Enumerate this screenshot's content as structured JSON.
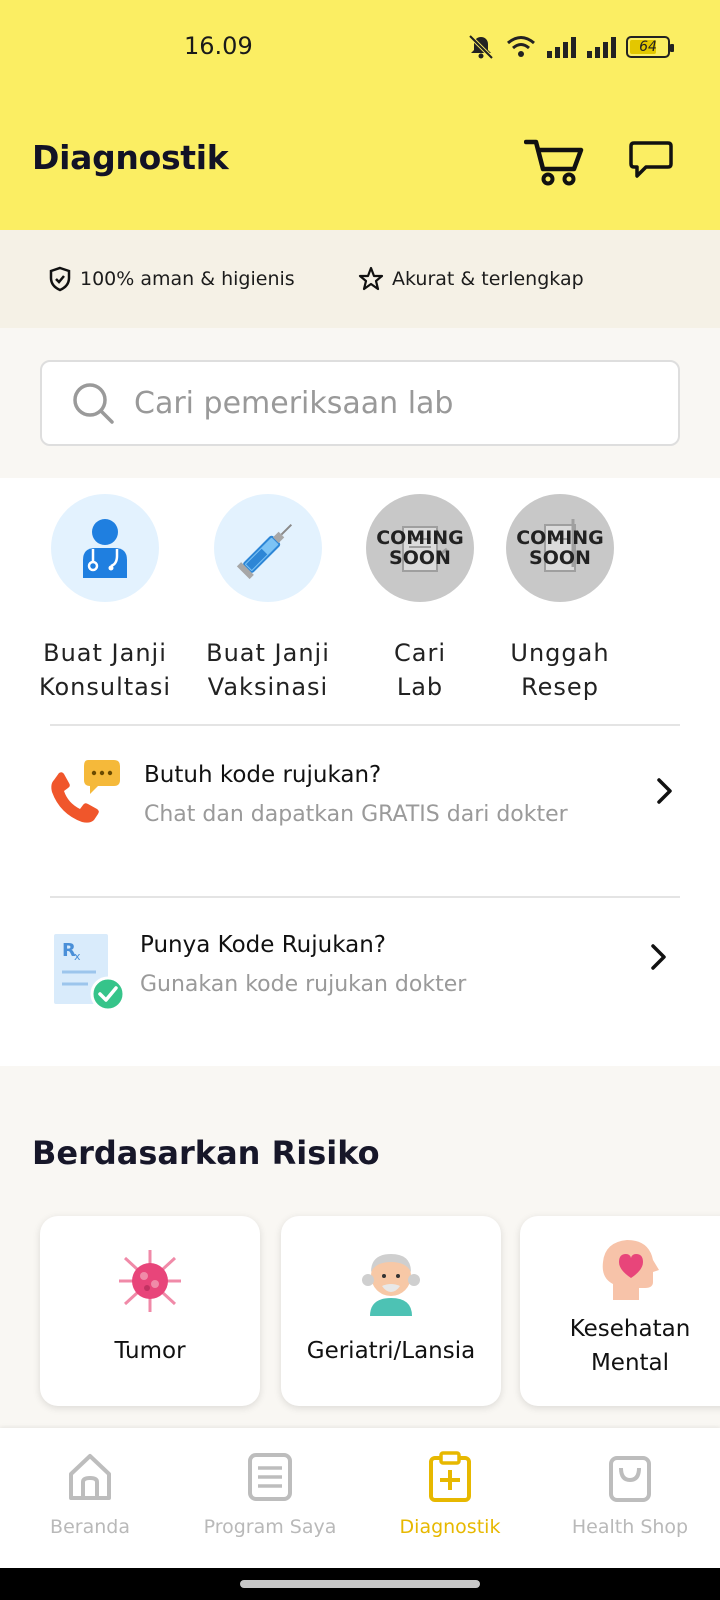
{
  "status_bar": {
    "time": "16.09",
    "battery": "64"
  },
  "header": {
    "title": "Diagnostik"
  },
  "assurances": [
    {
      "icon": "shield-icon",
      "label": "100% aman & higienis"
    },
    {
      "icon": "star-icon",
      "label": "Akurat & terlengkap"
    }
  ],
  "search": {
    "placeholder": "Cari pemeriksaan lab"
  },
  "services": [
    {
      "icon": "doctor-icon",
      "label": "Buat Janji\nKonsultasi",
      "coming_soon": false
    },
    {
      "icon": "syringe-icon",
      "label": "Buat Janji\nVaksinasi",
      "coming_soon": false
    },
    {
      "icon": "lab-icon",
      "label": "Cari\nLab",
      "coming_soon": true,
      "badge": "COMING\nSOON"
    },
    {
      "icon": "prescription-upload-icon",
      "label": "Unggah\nResep",
      "coming_soon": true,
      "badge": "COMING\nSOON"
    }
  ],
  "promos": [
    {
      "icon": "phone-chat-icon",
      "title": "Butuh kode rujukan?",
      "subtitle": "Chat dan dapatkan GRATIS dari dokter"
    },
    {
      "icon": "prescription-check-icon",
      "title": "Punya Kode Rujukan?",
      "subtitle": "Gunakan kode rujukan dokter"
    }
  ],
  "risk_section": {
    "title": "Berdasarkan Risiko",
    "items": [
      {
        "icon": "tumor-icon",
        "label": "Tumor"
      },
      {
        "icon": "elderly-icon",
        "label": "Geriatri/Lansia"
      },
      {
        "icon": "mental-health-icon",
        "label": "Kesehatan\nMental"
      }
    ]
  },
  "bottom_nav": {
    "items": [
      {
        "icon": "home-icon",
        "label": "Beranda",
        "active": false
      },
      {
        "icon": "list-icon",
        "label": "Program Saya",
        "active": false
      },
      {
        "icon": "clipboard-plus-icon",
        "label": "Diagnostik",
        "active": true
      },
      {
        "icon": "bag-icon",
        "label": "Health Shop",
        "active": false
      }
    ]
  },
  "colors": {
    "header_bg": "#fbee63",
    "accent": "#e7b800",
    "band_bg": "#f5f1e6"
  }
}
